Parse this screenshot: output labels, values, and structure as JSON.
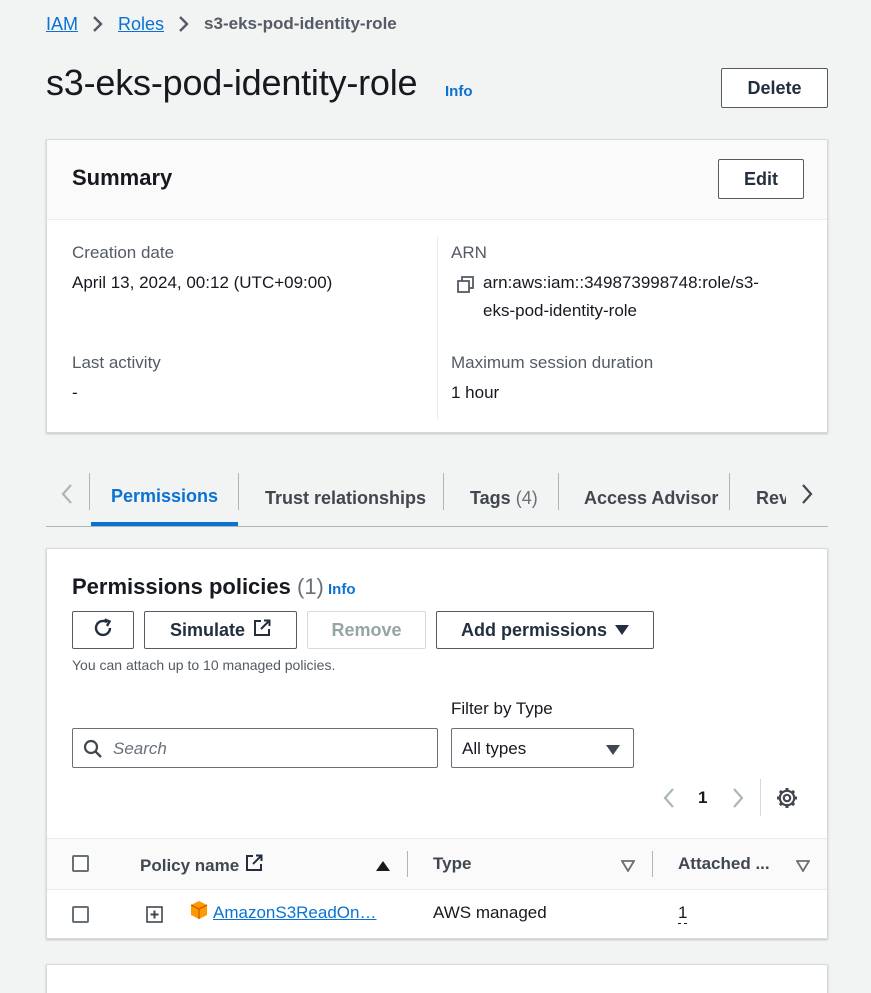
{
  "breadcrumb": {
    "iam": "IAM",
    "roles": "Roles",
    "current": "s3-eks-pod-identity-role"
  },
  "page": {
    "title": "s3-eks-pod-identity-role",
    "info": "Info",
    "delete_label": "Delete"
  },
  "summary": {
    "title": "Summary",
    "edit_label": "Edit",
    "creation_date_label": "Creation date",
    "creation_date_value": "April 13, 2024, 00:12 (UTC+09:00)",
    "arn_label": "ARN",
    "arn_line1": "arn:aws:iam::349873998748:role/s3-",
    "arn_line2": "eks-pod-identity-role",
    "last_activity_label": "Last activity",
    "last_activity_value": "-",
    "max_session_label": "Maximum session duration",
    "max_session_value": "1 hour"
  },
  "tabs": [
    {
      "label": "Permissions"
    },
    {
      "label": "Trust relationships"
    },
    {
      "label": "Tags",
      "count": "(4)"
    },
    {
      "label": "Access Advisor"
    },
    {
      "label": "Rev"
    }
  ],
  "permissions": {
    "title": "Permissions policies",
    "count": "(1)",
    "info": "Info",
    "simulate_label": "Simulate",
    "remove_label": "Remove",
    "add_permissions_label": "Add permissions",
    "hint": "You can attach up to 10 managed policies.",
    "filter_label": "Filter by Type",
    "search_placeholder": "Search",
    "filter_value": "All types",
    "page_number": "1",
    "columns": {
      "policy_name": "Policy name",
      "type": "Type",
      "attached": "Attached ..."
    },
    "rows": [
      {
        "name": "AmazonS3ReadOn…",
        "type": "AWS managed",
        "attached": "1"
      }
    ]
  },
  "colors": {
    "link": "#0972d3",
    "aws_orange": "#ff9900"
  },
  "icons": [
    "chevron-right-icon",
    "copy-icon",
    "refresh-icon",
    "external-link-icon",
    "caret-down-icon",
    "search-icon",
    "settings-icon",
    "expand-icon",
    "policy-icon"
  ]
}
